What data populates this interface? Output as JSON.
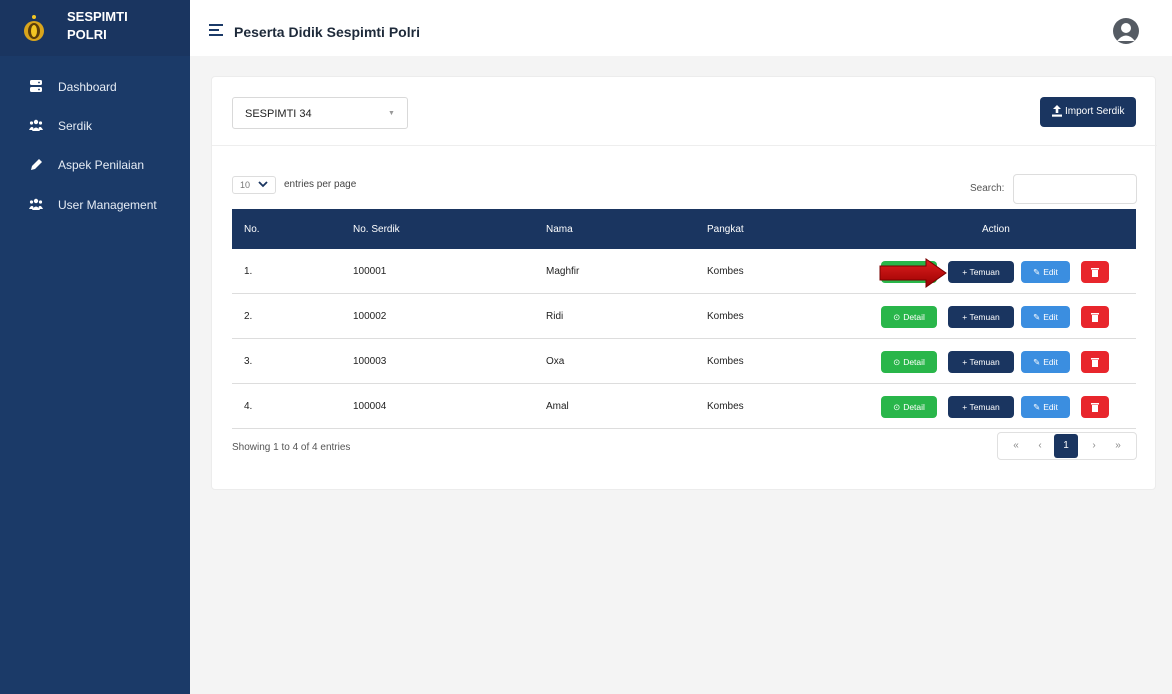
{
  "sidebar": {
    "brand_line1": "SESPIMTI",
    "brand_line2": "POLRI",
    "items": [
      {
        "label": "Dashboard",
        "icon": "database-icon"
      },
      {
        "label": "Serdik",
        "icon": "users-icon"
      },
      {
        "label": "Aspek Penilaian",
        "icon": "pen-icon"
      },
      {
        "label": "User Management",
        "icon": "users-icon"
      }
    ]
  },
  "header": {
    "title": "Peserta Didik Sespimti Polri",
    "avatar_icon": "user-circle-icon"
  },
  "filter": {
    "selected": "SESPIMTI 34",
    "import_label": "Import Serdik"
  },
  "table_controls": {
    "entries_value": "10",
    "entries_label": "entries per page",
    "search_label": "Search:",
    "search_value": ""
  },
  "table": {
    "columns": [
      "No.",
      "No. Serdik",
      "Nama",
      "Pangkat",
      "Action"
    ],
    "rows": [
      {
        "no": "1.",
        "serdik": "100001",
        "nama": "Maghfir",
        "pangkat": "Kombes"
      },
      {
        "no": "2.",
        "serdik": "100002",
        "nama": "Ridi",
        "pangkat": "Kombes"
      },
      {
        "no": "3.",
        "serdik": "100003",
        "nama": "Oxa",
        "pangkat": "Kombes"
      },
      {
        "no": "4.",
        "serdik": "100004",
        "nama": "Amal",
        "pangkat": "Kombes"
      }
    ],
    "actions": {
      "detail": "Detail",
      "temuan": "+ Temuan",
      "edit": "Edit"
    }
  },
  "footer": {
    "info": "Showing 1 to 4 of 4 entries",
    "pagination": [
      "«",
      "‹",
      "1",
      "›",
      "»"
    ],
    "current_page": "1"
  },
  "colors": {
    "sidebar": "#1b3a68",
    "primary": "#1a3560",
    "success": "#29b64a",
    "info": "#3b8ee0",
    "danger": "#e8262c",
    "annotation_arrow": "#c00000"
  }
}
